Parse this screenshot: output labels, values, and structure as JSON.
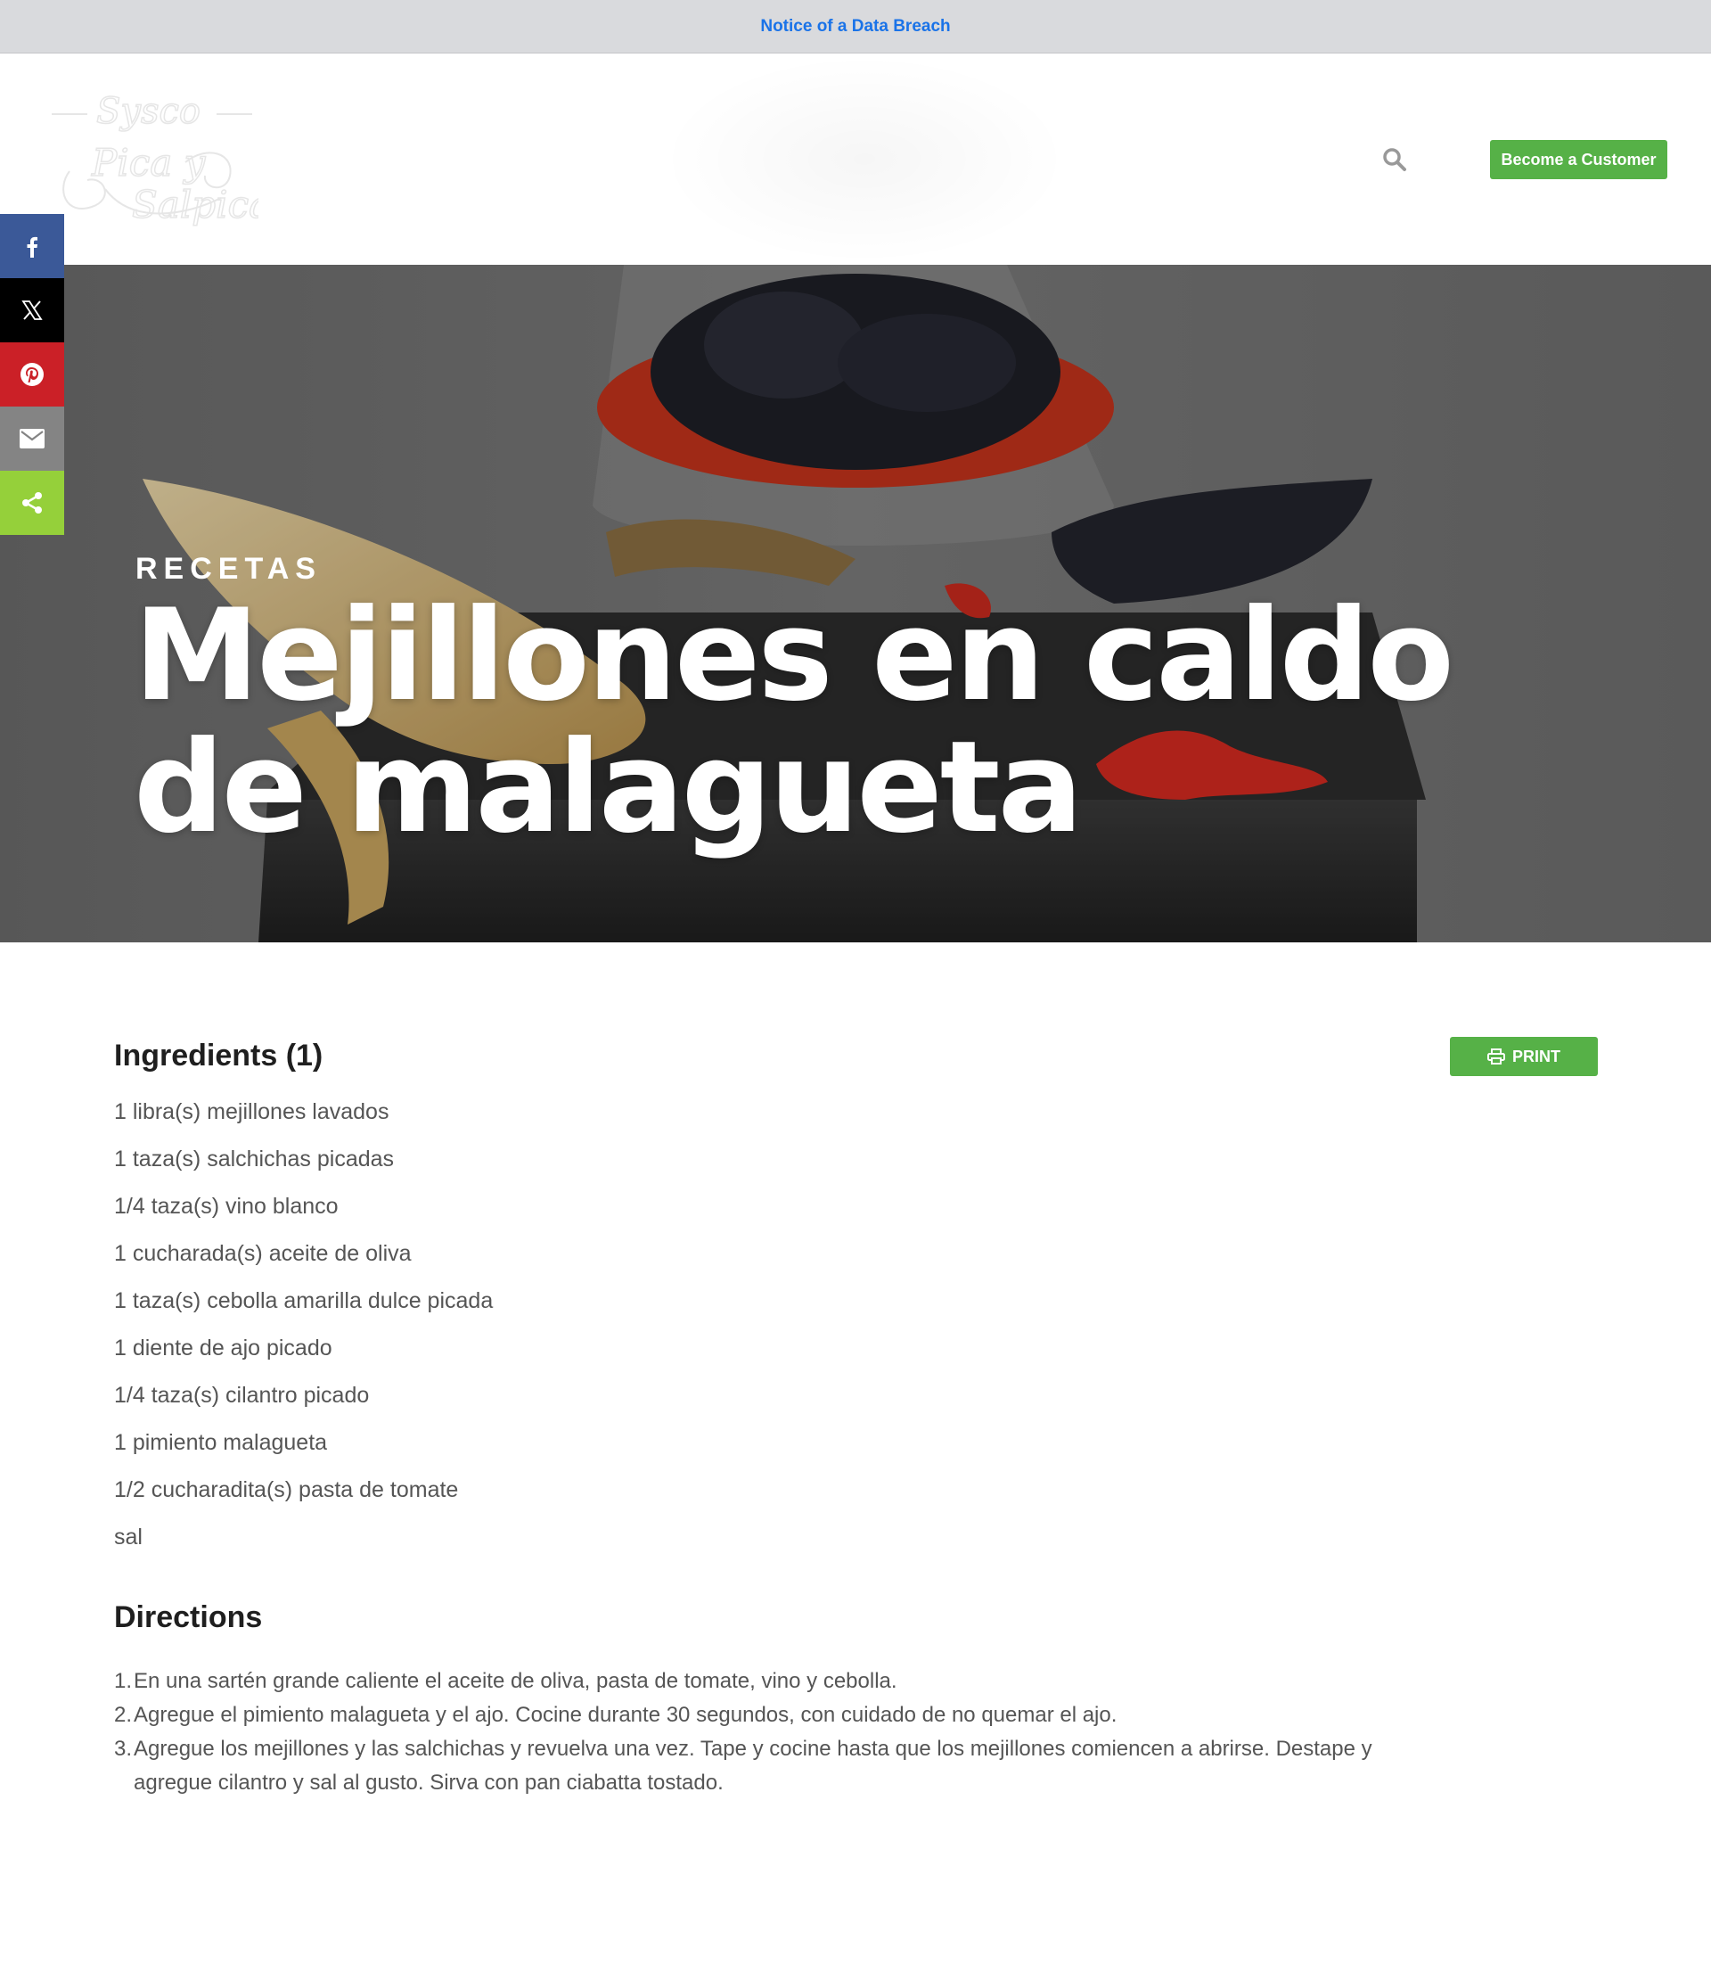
{
  "notice": {
    "text": "Notice of a Data Breach"
  },
  "header": {
    "logo_name": "Sysco Pica y Salpica",
    "search_icon": "search-icon",
    "cta_label": "Become a Customer"
  },
  "share": {
    "items": [
      {
        "name": "facebook",
        "icon": "facebook-icon",
        "color": "#3b5998"
      },
      {
        "name": "x",
        "icon": "x-icon",
        "color": "#000000"
      },
      {
        "name": "pinterest",
        "icon": "pinterest-icon",
        "color": "#cb2027"
      },
      {
        "name": "email",
        "icon": "email-icon",
        "color": "#848484"
      },
      {
        "name": "share",
        "icon": "share-icon",
        "color": "#95d03a"
      }
    ]
  },
  "hero": {
    "kicker": "RECETAS",
    "title": "Mejillones en caldo de malagueta"
  },
  "recipe": {
    "ingredients_heading": "Ingredients (1)",
    "print_label": "PRINT",
    "ingredients": [
      "1 libra(s) mejillones lavados",
      "1 taza(s) salchichas picadas",
      "1/4 taza(s) vino blanco",
      "1 cucharada(s) aceite de oliva",
      "1 taza(s) cebolla amarilla dulce picada",
      "1 diente de ajo picado",
      "1/4 taza(s) cilantro picado",
      "1 pimiento malagueta",
      "1/2 cucharadita(s) pasta de tomate",
      "sal"
    ],
    "directions_heading": "Directions",
    "directions": [
      {
        "num": "1.",
        "text": "En una sartén grande caliente el aceite de oliva, pasta de tomate, vino y cebolla."
      },
      {
        "num": "2.",
        "text": "Agregue el pimiento malagueta y el ajo. Cocine durante 30 segundos, con cuidado de no quemar el ajo."
      },
      {
        "num": "3.",
        "text": "Agregue los mejillones y las salchichas y revuelva una vez. Tape y cocine hasta que los mejillones comiencen a abrirse. Destape y agregue cilantro y sal al gusto. Sirva con pan ciabatta tostado."
      }
    ]
  },
  "colors": {
    "accent_green": "#56b147",
    "notice_link": "#1a73e8",
    "notice_bg": "#d9dadd"
  }
}
